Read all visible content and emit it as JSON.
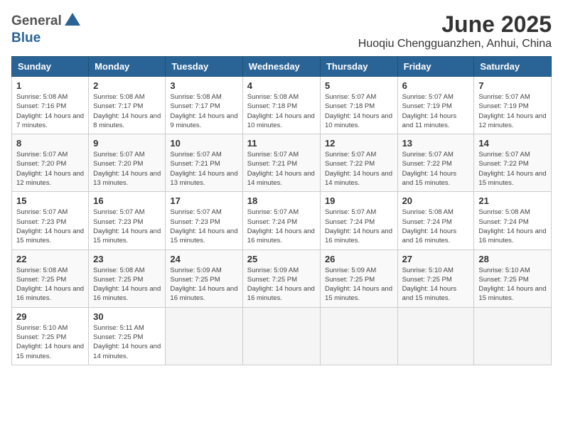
{
  "header": {
    "logo_general": "General",
    "logo_blue": "Blue",
    "month_title": "June 2025",
    "location": "Huoqiu Chengguanzhen, Anhui, China"
  },
  "weekdays": [
    "Sunday",
    "Monday",
    "Tuesday",
    "Wednesday",
    "Thursday",
    "Friday",
    "Saturday"
  ],
  "weeks": [
    [
      {
        "day": "1",
        "sunrise": "5:08 AM",
        "sunset": "7:16 PM",
        "daylight": "14 hours and 7 minutes."
      },
      {
        "day": "2",
        "sunrise": "5:08 AM",
        "sunset": "7:17 PM",
        "daylight": "14 hours and 8 minutes."
      },
      {
        "day": "3",
        "sunrise": "5:08 AM",
        "sunset": "7:17 PM",
        "daylight": "14 hours and 9 minutes."
      },
      {
        "day": "4",
        "sunrise": "5:08 AM",
        "sunset": "7:18 PM",
        "daylight": "14 hours and 10 minutes."
      },
      {
        "day": "5",
        "sunrise": "5:07 AM",
        "sunset": "7:18 PM",
        "daylight": "14 hours and 10 minutes."
      },
      {
        "day": "6",
        "sunrise": "5:07 AM",
        "sunset": "7:19 PM",
        "daylight": "14 hours and 11 minutes."
      },
      {
        "day": "7",
        "sunrise": "5:07 AM",
        "sunset": "7:19 PM",
        "daylight": "14 hours and 12 minutes."
      }
    ],
    [
      {
        "day": "8",
        "sunrise": "5:07 AM",
        "sunset": "7:20 PM",
        "daylight": "14 hours and 12 minutes."
      },
      {
        "day": "9",
        "sunrise": "5:07 AM",
        "sunset": "7:20 PM",
        "daylight": "14 hours and 13 minutes."
      },
      {
        "day": "10",
        "sunrise": "5:07 AM",
        "sunset": "7:21 PM",
        "daylight": "14 hours and 13 minutes."
      },
      {
        "day": "11",
        "sunrise": "5:07 AM",
        "sunset": "7:21 PM",
        "daylight": "14 hours and 14 minutes."
      },
      {
        "day": "12",
        "sunrise": "5:07 AM",
        "sunset": "7:22 PM",
        "daylight": "14 hours and 14 minutes."
      },
      {
        "day": "13",
        "sunrise": "5:07 AM",
        "sunset": "7:22 PM",
        "daylight": "14 hours and 15 minutes."
      },
      {
        "day": "14",
        "sunrise": "5:07 AM",
        "sunset": "7:22 PM",
        "daylight": "14 hours and 15 minutes."
      }
    ],
    [
      {
        "day": "15",
        "sunrise": "5:07 AM",
        "sunset": "7:23 PM",
        "daylight": "14 hours and 15 minutes."
      },
      {
        "day": "16",
        "sunrise": "5:07 AM",
        "sunset": "7:23 PM",
        "daylight": "14 hours and 15 minutes."
      },
      {
        "day": "17",
        "sunrise": "5:07 AM",
        "sunset": "7:23 PM",
        "daylight": "14 hours and 15 minutes."
      },
      {
        "day": "18",
        "sunrise": "5:07 AM",
        "sunset": "7:24 PM",
        "daylight": "14 hours and 16 minutes."
      },
      {
        "day": "19",
        "sunrise": "5:07 AM",
        "sunset": "7:24 PM",
        "daylight": "14 hours and 16 minutes."
      },
      {
        "day": "20",
        "sunrise": "5:08 AM",
        "sunset": "7:24 PM",
        "daylight": "14 hours and 16 minutes."
      },
      {
        "day": "21",
        "sunrise": "5:08 AM",
        "sunset": "7:24 PM",
        "daylight": "14 hours and 16 minutes."
      }
    ],
    [
      {
        "day": "22",
        "sunrise": "5:08 AM",
        "sunset": "7:25 PM",
        "daylight": "14 hours and 16 minutes."
      },
      {
        "day": "23",
        "sunrise": "5:08 AM",
        "sunset": "7:25 PM",
        "daylight": "14 hours and 16 minutes."
      },
      {
        "day": "24",
        "sunrise": "5:09 AM",
        "sunset": "7:25 PM",
        "daylight": "14 hours and 16 minutes."
      },
      {
        "day": "25",
        "sunrise": "5:09 AM",
        "sunset": "7:25 PM",
        "daylight": "14 hours and 16 minutes."
      },
      {
        "day": "26",
        "sunrise": "5:09 AM",
        "sunset": "7:25 PM",
        "daylight": "14 hours and 15 minutes."
      },
      {
        "day": "27",
        "sunrise": "5:10 AM",
        "sunset": "7:25 PM",
        "daylight": "14 hours and 15 minutes."
      },
      {
        "day": "28",
        "sunrise": "5:10 AM",
        "sunset": "7:25 PM",
        "daylight": "14 hours and 15 minutes."
      }
    ],
    [
      {
        "day": "29",
        "sunrise": "5:10 AM",
        "sunset": "7:25 PM",
        "daylight": "14 hours and 15 minutes."
      },
      {
        "day": "30",
        "sunrise": "5:11 AM",
        "sunset": "7:25 PM",
        "daylight": "14 hours and 14 minutes."
      },
      null,
      null,
      null,
      null,
      null
    ]
  ]
}
